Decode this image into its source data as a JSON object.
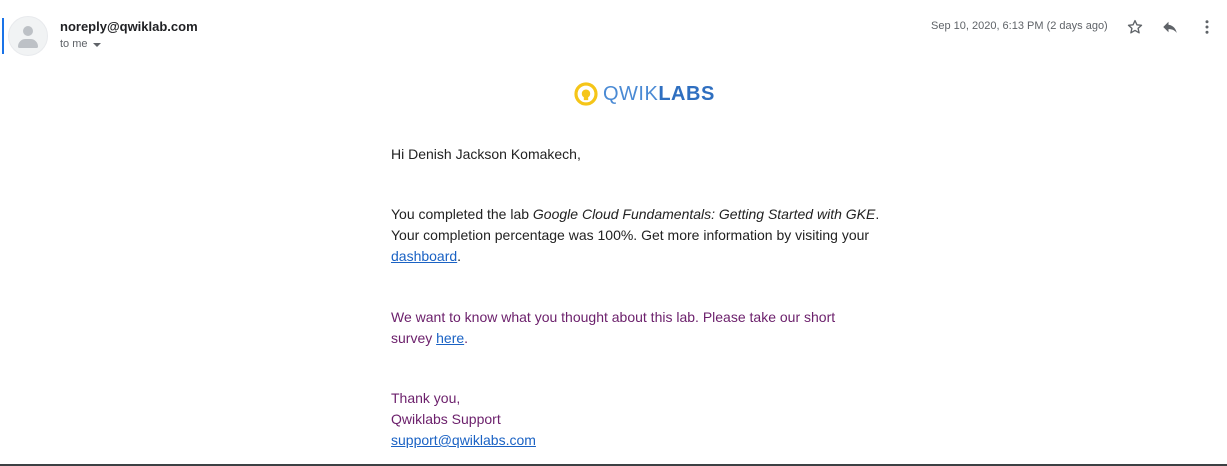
{
  "header": {
    "sender": "noreply@qwiklab.com",
    "recipient_label": "to me",
    "date": "Sep 10, 2020, 6:13 PM (2 days ago)",
    "icons": [
      "star-icon",
      "reply-icon",
      "more-vert-icon"
    ]
  },
  "logo": {
    "text_light": "QWIK",
    "text_bold": "LABS",
    "mark_color": "#f5c518",
    "text_color": "#3d7fc9"
  },
  "body": {
    "greeting": "Hi Denish Jackson Komakech,",
    "completed_prefix": "You completed the lab ",
    "lab_name": "Google Cloud Fundamentals: Getting Started with GKE",
    "completed_suffix": ".",
    "percentage_line": "Your completion percentage was 100%. Get more information by visiting your",
    "dashboard_link": "dashboard",
    "period": ".",
    "survey_line1": "We want to know what you thought about this lab. Please take our short",
    "survey_prefix": "survey ",
    "survey_link": "here",
    "thanks": "Thank you,",
    "signature": "Qwiklabs Support",
    "support_email": "support@qwiklabs.com"
  },
  "colors": {
    "link": "#1a62c4",
    "purple_text": "#6b1f6b",
    "focus_bar": "#1a73e8"
  }
}
